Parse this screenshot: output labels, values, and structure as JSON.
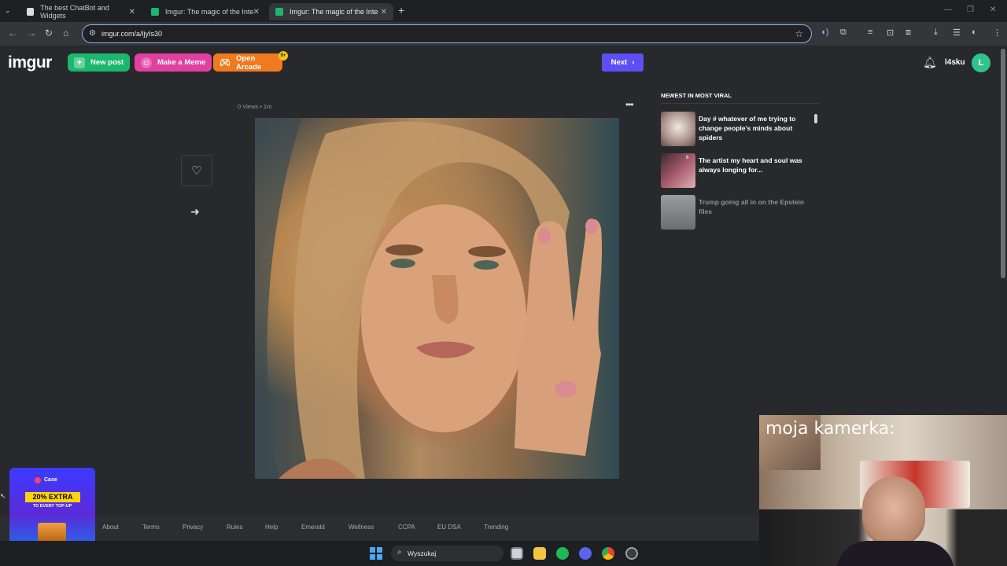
{
  "browser": {
    "tabs": [
      {
        "title": "The best ChatBot and Widgets",
        "active": false
      },
      {
        "title": "Imgur: The magic of the Interne",
        "active": false
      },
      {
        "title": "Imgur: The magic of the Interne",
        "active": true
      }
    ],
    "url": "imgur.com/a/ljyIs30"
  },
  "header": {
    "logo": "imgur",
    "new_post": "New post",
    "make_meme": "Make a Meme",
    "open_arcade": "Open Arcade",
    "arcade_badge": "9+",
    "next": "Next",
    "username": "l4sku",
    "avatar_letter": "L"
  },
  "post": {
    "meta": "0 Views • 1m"
  },
  "sidebar": {
    "title": "NEWEST IN MOST VIRAL",
    "items": [
      {
        "text": "Day # whatever of me trying to change people's minds about spiders",
        "count": ""
      },
      {
        "text": "The artist my heart and soul was always longing for...",
        "count": "6"
      },
      {
        "text": "Trump going all in on the Epstein files",
        "count": ""
      }
    ]
  },
  "footer": {
    "links": [
      "About",
      "Terms",
      "Privacy",
      "Rules",
      "Help",
      "Emerald",
      "Wellness",
      "CCPA",
      "EU DSA",
      "Trending"
    ]
  },
  "ad": {
    "brand": "Case",
    "promo": "20% EXTRA",
    "sub": "TO EVERY TOP-UP"
  },
  "taskbar": {
    "search_placeholder": "Wyszukaj"
  },
  "webcam": {
    "label": "moja kamerka:"
  },
  "colors": {
    "page_bg": "#27292d",
    "new_post": "#1bb76e",
    "make_meme": "#e040a0",
    "open_arcade": "#f07a1f",
    "next": "#5c4ff5"
  }
}
